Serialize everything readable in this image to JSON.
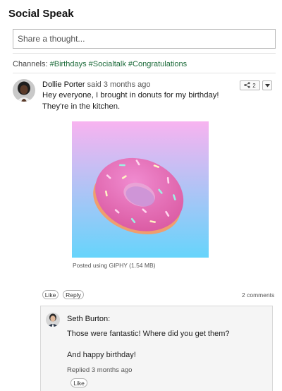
{
  "app": {
    "title": "Social Speak"
  },
  "composer": {
    "placeholder": "Share a thought..."
  },
  "channels": {
    "label": "Channels:",
    "tags": [
      "#Birthdays",
      "#Socialtalk",
      "#Congratulations"
    ]
  },
  "post": {
    "author": "Dollie Porter",
    "meta": "said 3 months ago",
    "body": "Hey everyone, I brought in donuts for my birthday! They're in the kitchen.",
    "share_count": "2",
    "share_icon": "share-icon",
    "menu_icon": "caret-down-icon",
    "attachment_caption": "Posted using GIPHY (1.54 MB)",
    "actions": {
      "like": "Like",
      "reply": "Reply"
    },
    "comments_count": "2 comments"
  },
  "comment": {
    "author": "Seth Burton:",
    "lines": [
      "Those were fantastic! Where did you get them?",
      "And happy birthday!"
    ],
    "meta": "Replied 3 months ago",
    "like": "Like"
  },
  "colors": {
    "channel_link": "#1c6b3a",
    "gif_top": "#f8b3f0",
    "gif_bottom": "#66d4fb",
    "donut": "#e86fc2"
  }
}
